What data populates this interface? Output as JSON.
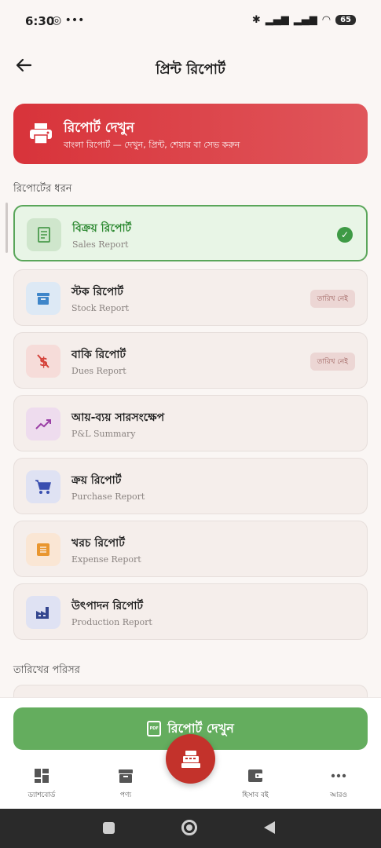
{
  "status_bar": {
    "time": "6:30",
    "battery": "65"
  },
  "app_bar": {
    "title": "প্রিন্ট রিপোর্ট"
  },
  "banner": {
    "title": "রিপোর্ট দেখুন",
    "subtitle": "বাংলা রিপোর্ট — দেখুন, প্রিন্ট, শেয়ার বা সেভ করুন"
  },
  "section_report_type": "রিপোর্টের ধরন",
  "reports": [
    {
      "name": "বিক্রয় রিপোর্ট",
      "en": "Sales Report",
      "icon": "receipt-icon",
      "selected": true
    },
    {
      "name": "স্টক রিপোর্ট",
      "en": "Stock Report",
      "icon": "archive-icon",
      "badge": "তারিখ নেই"
    },
    {
      "name": "বাকি রিপোর্ট",
      "en": "Dues Report",
      "icon": "money-off-icon",
      "badge": "তারিখ নেই"
    },
    {
      "name": "আয়-ব্যয় সারসংক্ষেপ",
      "en": "P&L Summary",
      "icon": "trending-up-icon"
    },
    {
      "name": "ক্রয় রিপোর্ট",
      "en": "Purchase Report",
      "icon": "cart-icon"
    },
    {
      "name": "খরচ রিপোর্ট",
      "en": "Expense Report",
      "icon": "document-icon"
    },
    {
      "name": "উৎপাদন রিপোর্ট",
      "en": "Production Report",
      "icon": "factory-icon"
    }
  ],
  "section_date_range": "তারিখের পরিসর",
  "cta": {
    "label": "রিপোর্ট দেখুন",
    "pdf": "PDF"
  },
  "nav": [
    {
      "label": "ড্যাশবোর্ড",
      "icon": "dashboard-icon"
    },
    {
      "label": "পণ্য",
      "icon": "inventory-icon"
    },
    {
      "label": "হিসাব বই",
      "icon": "wallet-icon"
    },
    {
      "label": "আরও",
      "icon": "more-icon"
    }
  ],
  "colors": {
    "accent": "#d8333a",
    "success": "#5aa65a",
    "fab": "#c3322b"
  }
}
